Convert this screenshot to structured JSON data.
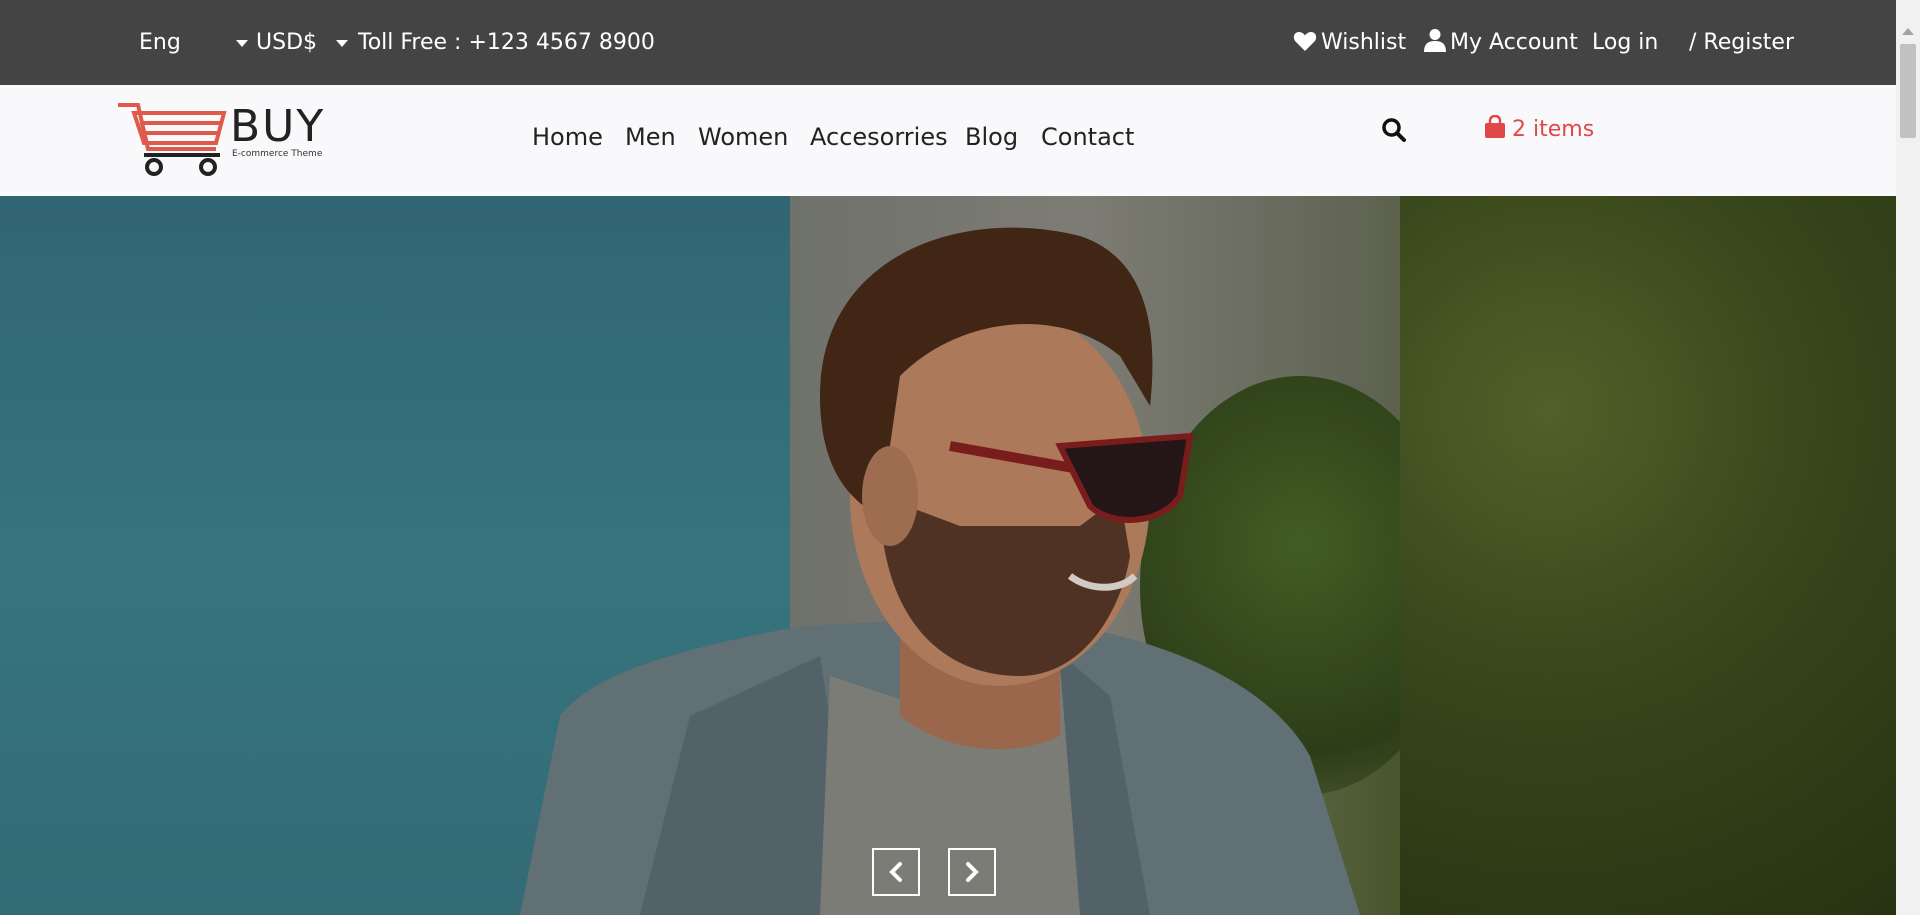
{
  "topbar": {
    "language": "Eng",
    "currency": "USD$",
    "toll_free": "Toll Free : +123 4567 8900",
    "wishlist": "Wishlist",
    "my_account": "My Account",
    "login": "Log in",
    "register": "/ Register"
  },
  "header": {
    "logo_text": "BUY",
    "logo_tagline": "E-commerce Theme",
    "nav": [
      {
        "label": "Home"
      },
      {
        "label": "Men"
      },
      {
        "label": "Women"
      },
      {
        "label": "Accesorries"
      },
      {
        "label": "Blog"
      },
      {
        "label": "Contact"
      }
    ],
    "search_icon": "search-icon",
    "cart_label": "2 items"
  },
  "hero": {
    "prev_icon": "chevron-left-icon",
    "next_icon": "chevron-right-icon"
  },
  "colors": {
    "topbar_bg": "#444444",
    "header_bg": "#f9f9fb",
    "accent": "#e04848"
  }
}
